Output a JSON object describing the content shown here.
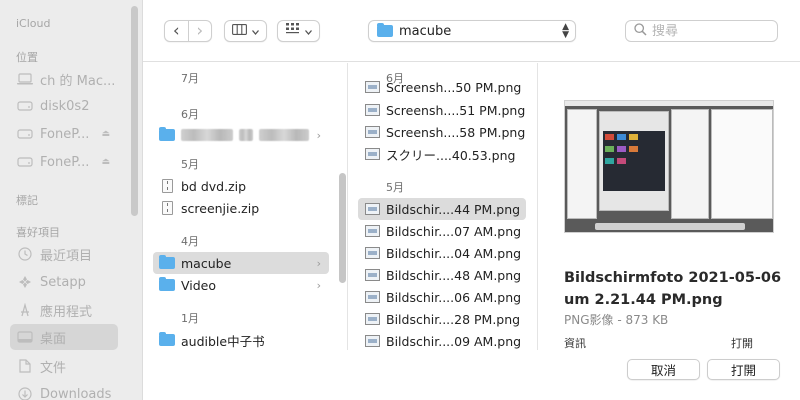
{
  "sidebar": {
    "sections": {
      "icloud": "iCloud",
      "locations": "位置",
      "tags": "標記",
      "favorites": "喜好項目"
    },
    "locations": [
      {
        "label": "ch 的 Mac...",
        "icon": "laptop-icon"
      },
      {
        "label": "disk0s2",
        "icon": "disk-icon"
      },
      {
        "label": "FoneP...",
        "icon": "disk-icon",
        "eject": "⏏"
      },
      {
        "label": "FoneP...",
        "icon": "disk-icon",
        "eject": "⏏"
      }
    ],
    "favorites": [
      {
        "label": "最近項目",
        "icon": "clock-icon"
      },
      {
        "label": "Setapp",
        "icon": "setapp-icon"
      },
      {
        "label": "應用程式",
        "icon": "applications-icon"
      },
      {
        "label": "桌面",
        "icon": "desktop-icon",
        "selected": true
      },
      {
        "label": "文件",
        "icon": "document-icon"
      },
      {
        "label": "Downloads",
        "icon": "download-icon"
      }
    ]
  },
  "toolbar": {
    "back": "‹",
    "forward": "›",
    "path": "macube",
    "search_placeholder": "搜尋"
  },
  "column1": {
    "groups": {
      "jul": "7月",
      "jun": "6月",
      "may": "5月",
      "apr": "4月",
      "jan": "1月"
    },
    "items": {
      "redacted": "",
      "bd_dvd": "bd dvd.zip",
      "screenjie": "screenjie.zip",
      "macube": "macube",
      "video": "Video",
      "audible": "audible中子书"
    }
  },
  "column2": {
    "groups": {
      "jun": "6月",
      "may": "5月"
    },
    "items": [
      "Screensh...50 PM.png",
      "Screensh....51 PM.png",
      "Screensh....58 PM.png",
      "スクリー....40.53.png",
      "Bildschir....44 PM.png",
      "Bildschir....07 AM.png",
      "Bildschir....04 AM.png",
      "Bildschir....48 AM.png",
      "Bildschir....06 AM.png",
      "Bildschir....28 PM.png",
      "Bildschir....09 AM.png"
    ]
  },
  "preview": {
    "title_line1": "Bildschirmfoto 2021-05-06",
    "title_line2": "um 2.21.44 PM.png",
    "meta": "PNG影像 - 873 KB",
    "more_left": "資訊",
    "more_right": "打開"
  },
  "buttons": {
    "cancel": "取消",
    "open": "打開"
  },
  "colors": {
    "folder": "#5ab0ec",
    "sidebar_bg": "#ececec",
    "selection": "#dcdcdc"
  }
}
